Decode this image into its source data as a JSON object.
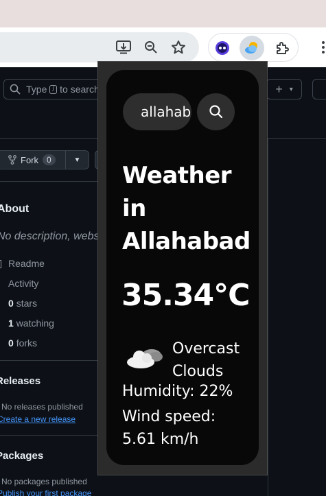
{
  "browser": {
    "toolbar_icons": [
      "install-app-icon",
      "zoom-out-icon",
      "bookmark-star-icon",
      "ext-face-icon",
      "weather-ext-icon",
      "extensions-puzzle-icon",
      "menu-kebab-icon"
    ]
  },
  "github": {
    "search_prefix": "Type",
    "search_key": "/",
    "search_suffix": "to search",
    "plus": "+",
    "plus_caret": "▾",
    "fork_label": "Fork",
    "fork_count": "0",
    "about_title": "About",
    "about_desc": "No description, website",
    "readme": "Readme",
    "activity": "Activity",
    "stars_count": "0",
    "stars_label": "stars",
    "watching_count": "1",
    "watching_label": "watching",
    "forks_count": "0",
    "forks_label": "forks",
    "releases_title": "Releases",
    "releases_note": "No releases published",
    "releases_link": "Create a new release",
    "packages_title": "Packages",
    "packages_note": "No packages published",
    "packages_link": "Publish your first package"
  },
  "weather": {
    "search_value": "allahabad",
    "heading": "Weather in Allahabad",
    "temperature": "35.34°C",
    "condition_icon": "cloud-icon",
    "description": "Overcast Clouds",
    "humidity": "Humidity: 22%",
    "wind": "Wind speed: 5.61 km/h"
  }
}
